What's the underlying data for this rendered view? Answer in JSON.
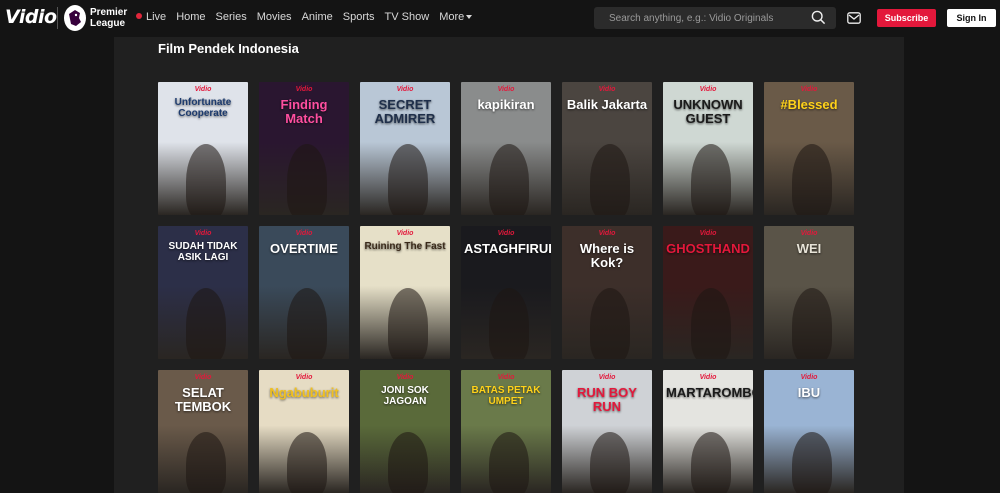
{
  "nav": {
    "logo": "Vidio",
    "premier_league": "Premier League",
    "items": [
      "Live",
      "Home",
      "Series",
      "Movies",
      "Anime",
      "Sports",
      "TV Show",
      "More"
    ],
    "search_placeholder": "Search anything, e.g.: Vidio Originals",
    "subscribe": "Subscribe",
    "signin": "Sign In"
  },
  "section_title": "Film Pendek Indonesia",
  "posters": [
    {
      "title": "Unfortunate Cooperate",
      "bg": "#dfe3ea",
      "fg": "#1d3b6e"
    },
    {
      "title": "Finding Match",
      "bg": "#2a1630",
      "fg": "#ff4fa0"
    },
    {
      "title": "SECRET ADMIRER",
      "bg": "#b9c7d6",
      "fg": "#1f2f4a"
    },
    {
      "title": "kapikiran",
      "bg": "#8a8c8c",
      "fg": "#ffffff"
    },
    {
      "title": "Balik Jakarta",
      "bg": "#4b4540",
      "fg": "#ffffff"
    },
    {
      "title": "UNKNOWN GUEST",
      "bg": "#cfd8d3",
      "fg": "#1a1a1a"
    },
    {
      "title": "#Blessed",
      "bg": "#6a5a48",
      "fg": "#ffd21a"
    },
    {
      "title": "SUDAH TIDAK ASIK LAGI",
      "bg": "#2c2f48",
      "fg": "#ffffff"
    },
    {
      "title": "OVERTIME",
      "bg": "#3a4a5a",
      "fg": "#ffffff"
    },
    {
      "title": "Ruining The Fast",
      "bg": "#e6e0c8",
      "fg": "#3a2a1a"
    },
    {
      "title": "ASTAGHFIRULLAH",
      "bg": "#1a1a1e",
      "fg": "#ffffff"
    },
    {
      "title": "Where is Kok?",
      "bg": "#3d2f2a",
      "fg": "#ffffff"
    },
    {
      "title": "GHOSTHAND",
      "bg": "#3a1a1a",
      "fg": "#e3183b"
    },
    {
      "title": "WEI",
      "bg": "#5a5448",
      "fg": "#e8e4d8"
    },
    {
      "title": "SELAT TEMBOK",
      "bg": "#6a5a4a",
      "fg": "#ffffff"
    },
    {
      "title": "Ngabuburit",
      "bg": "#e6dcc4",
      "fg": "#f0c020"
    },
    {
      "title": "JONI SOK JAGOAN",
      "bg": "#5a6a3a",
      "fg": "#ffffff"
    },
    {
      "title": "BATAS PETAK UMPET",
      "bg": "#6a7a4a",
      "fg": "#ffd21a"
    },
    {
      "title": "RUN BOY RUN",
      "bg": "#cfd2d6",
      "fg": "#e3183b"
    },
    {
      "title": "MARTAROMBO",
      "bg": "#e4e4e0",
      "fg": "#1a1a1a"
    },
    {
      "title": "IBU",
      "bg": "#9ab4d4",
      "fg": "#ffffff"
    }
  ]
}
